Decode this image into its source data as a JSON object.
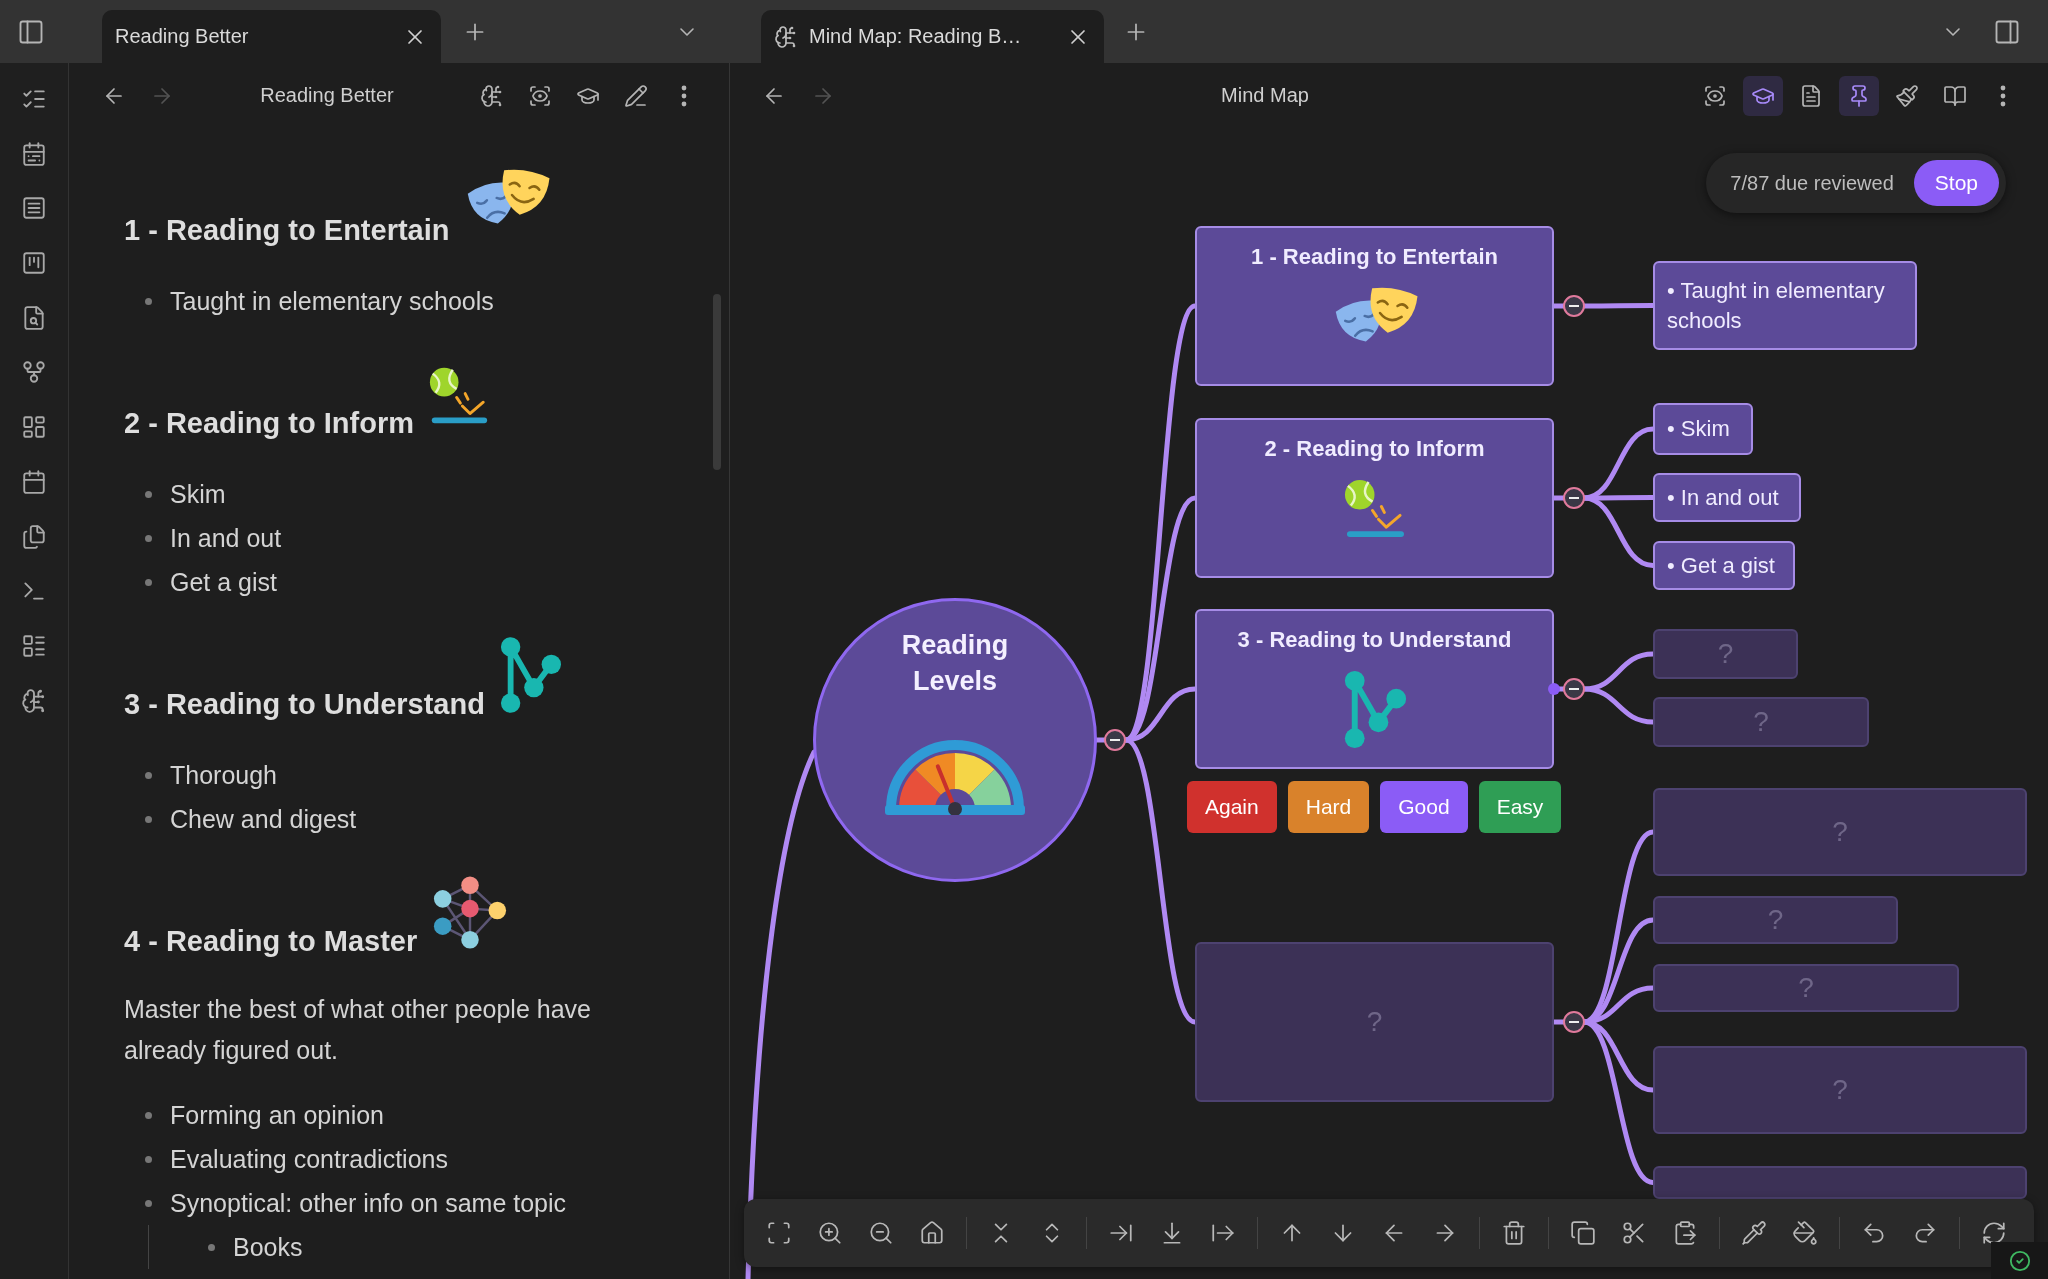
{
  "left_pane": {
    "tabs": [
      {
        "label": "Reading Better",
        "selected": true
      }
    ],
    "header": {
      "title": "Reading Better",
      "forward_disabled": true
    },
    "note": {
      "sections": [
        {
          "heading": "1 - Reading to Entertain",
          "bullets": [
            {
              "text": "Taught in elementary schools"
            }
          ]
        },
        {
          "heading": "2 - Reading to Inform",
          "bullets": [
            {
              "text": "Skim"
            },
            {
              "text": "In and out"
            },
            {
              "text": "Get a gist"
            }
          ]
        },
        {
          "heading": "3 - Reading to Understand",
          "bullets": [
            {
              "text": "Thorough"
            },
            {
              "text": "Chew and digest"
            }
          ]
        },
        {
          "heading": "4 - Reading to Master",
          "paragraph": "Master the best of what other people have already figured out.",
          "bullets": [
            {
              "text": "Forming an opinion"
            },
            {
              "text": "Evaluating contradictions"
            },
            {
              "text": "Synoptical: other info on same topic",
              "children": [
                {
                  "text": "Books"
                }
              ]
            }
          ]
        }
      ]
    }
  },
  "right_pane": {
    "tabs": [
      {
        "label": "Mind Map: Reading B…",
        "selected": true
      }
    ],
    "header": {
      "title": "Mind Map",
      "forward_disabled": true,
      "actions": [
        {
          "active": false
        },
        {
          "active": true
        },
        {
          "active": false
        },
        {
          "active": true
        },
        {
          "active": false
        },
        {
          "active": false
        },
        {
          "active": false
        }
      ]
    },
    "review": {
      "status": "7/87 due reviewed",
      "stop_label": "Stop"
    },
    "mind_map": {
      "root": {
        "label": "Reading Levels",
        "expanded": true
      },
      "branches": [
        {
          "label": "1 - Reading to Entertain",
          "hidden": false,
          "selected": false,
          "expanded": true,
          "children": [
            {
              "label": "• Taught in elementary schools",
              "hidden": false
            }
          ]
        },
        {
          "label": "2 - Reading to Inform",
          "hidden": false,
          "selected": false,
          "expanded": true,
          "children": [
            {
              "label": "• Skim",
              "hidden": false
            },
            {
              "label": "• In and out",
              "hidden": false
            },
            {
              "label": "• Get a gist",
              "hidden": false
            }
          ]
        },
        {
          "label": "3 - Reading to Understand",
          "hidden": false,
          "selected": true,
          "expanded": true,
          "children": [
            {
              "label": "?",
              "hidden": true
            },
            {
              "label": "?",
              "hidden": true
            }
          ]
        },
        {
          "label": "?",
          "hidden": true,
          "selected": false,
          "expanded": true,
          "children": [
            {
              "label": "?",
              "hidden": true
            },
            {
              "label": "?",
              "hidden": true
            },
            {
              "label": "?",
              "hidden": true
            },
            {
              "label": "?",
              "hidden": true
            },
            {
              "hidden": true
            }
          ]
        }
      ],
      "rating_buttons": [
        {
          "label": "Again",
          "color": "#d0312d"
        },
        {
          "label": "Hard",
          "color": "#d9822b"
        },
        {
          "label": "Good",
          "color": "#8b5cf6"
        },
        {
          "label": "Easy",
          "color": "#2f9e55"
        }
      ]
    }
  }
}
